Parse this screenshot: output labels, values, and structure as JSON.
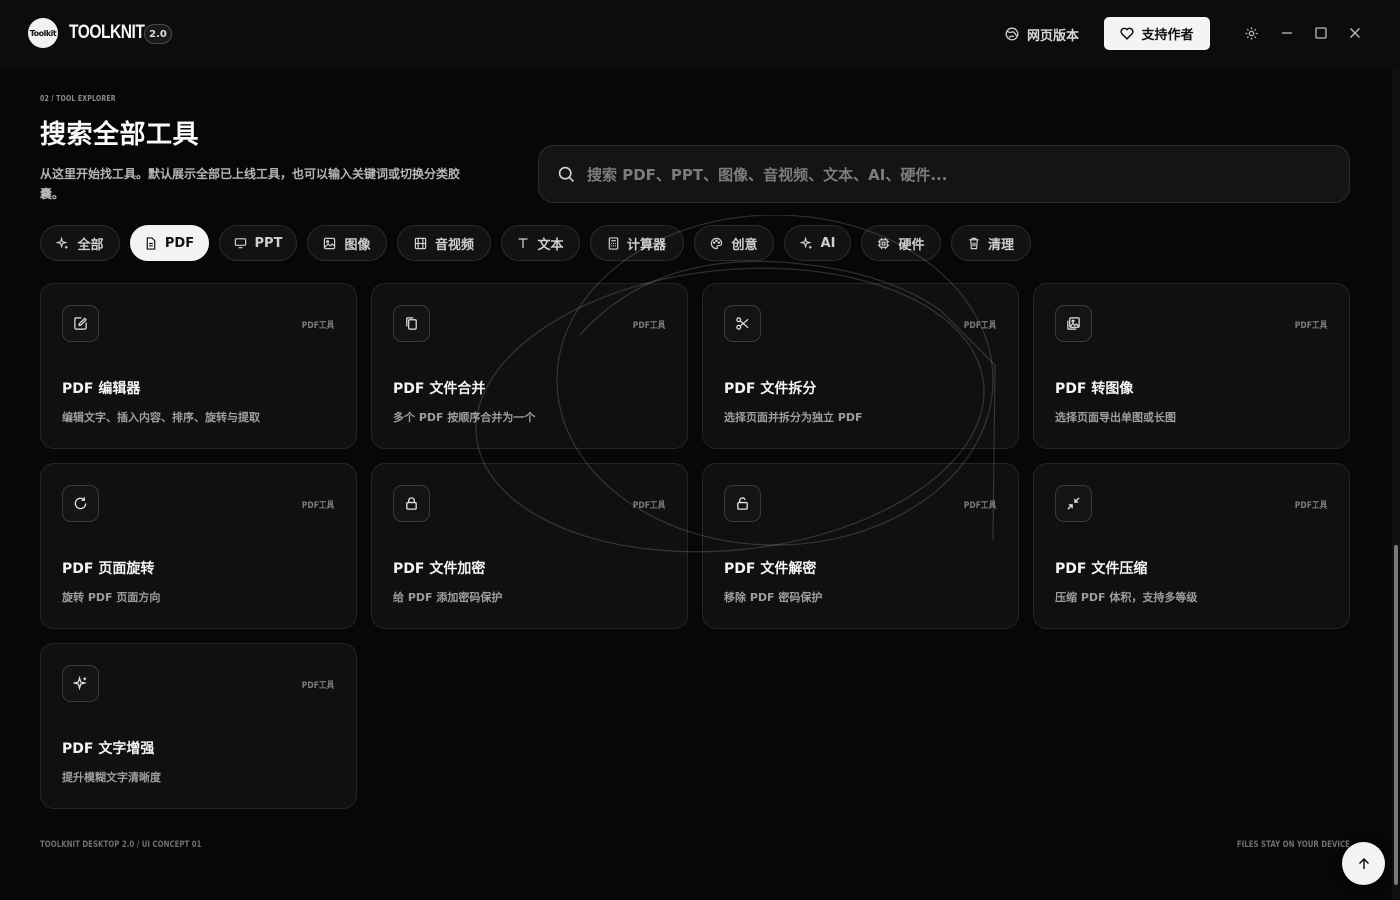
{
  "app": {
    "logo_text": "Toolkit",
    "name": "TOOLKNIT",
    "version": "2.0",
    "web_label": "网页版本",
    "support_label": "支持作者"
  },
  "header": {
    "breadcrumb": "02 / TOOL EXPLORER",
    "title": "搜索全部工具",
    "description": "从这里开始找工具。默认展示全部已上线工具，也可以输入关键词或切换分类胶囊。"
  },
  "search": {
    "placeholder": "搜索 PDF、PPT、图像、音视频、文本、AI、硬件...",
    "value": ""
  },
  "categories": [
    {
      "label": "全部",
      "icon": "sparkle-icon",
      "active": false
    },
    {
      "label": "PDF",
      "icon": "document-icon",
      "active": true
    },
    {
      "label": "PPT",
      "icon": "presentation-icon",
      "active": false
    },
    {
      "label": "图像",
      "icon": "image-icon",
      "active": false
    },
    {
      "label": "音视频",
      "icon": "film-icon",
      "active": false
    },
    {
      "label": "文本",
      "icon": "text-icon",
      "active": false
    },
    {
      "label": "计算器",
      "icon": "calculator-icon",
      "active": false
    },
    {
      "label": "创意",
      "icon": "palette-icon",
      "active": false
    },
    {
      "label": "AI",
      "icon": "ai-sparkle-icon",
      "active": false
    },
    {
      "label": "硬件",
      "icon": "chip-icon",
      "active": false
    },
    {
      "label": "清理",
      "icon": "trash-icon",
      "active": false
    }
  ],
  "tools": [
    {
      "title": "PDF 编辑器",
      "desc": "编辑文字、插入内容、排序、旋转与提取",
      "tag": "PDF工具",
      "icon": "edit-icon"
    },
    {
      "title": "PDF 文件合并",
      "desc": "多个 PDF 按顺序合并为一个",
      "tag": "PDF工具",
      "icon": "copy-icon"
    },
    {
      "title": "PDF 文件拆分",
      "desc": "选择页面并拆分为独立 PDF",
      "tag": "PDF工具",
      "icon": "scissors-icon"
    },
    {
      "title": "PDF 转图像",
      "desc": "选择页面导出单图或长图",
      "tag": "PDF工具",
      "icon": "images-icon"
    },
    {
      "title": "PDF 页面旋转",
      "desc": "旋转 PDF 页面方向",
      "tag": "PDF工具",
      "icon": "rotate-icon"
    },
    {
      "title": "PDF 文件加密",
      "desc": "给 PDF 添加密码保护",
      "tag": "PDF工具",
      "icon": "lock-icon"
    },
    {
      "title": "PDF 文件解密",
      "desc": "移除 PDF 密码保护",
      "tag": "PDF工具",
      "icon": "unlock-icon"
    },
    {
      "title": "PDF 文件压缩",
      "desc": "压缩 PDF 体积，支持多等级",
      "tag": "PDF工具",
      "icon": "compress-icon"
    },
    {
      "title": "PDF 文字增强",
      "desc": "提升模糊文字清晰度",
      "tag": "PDF工具",
      "icon": "sparkles-icon"
    }
  ],
  "footer": {
    "left": "TOOLKNIT DESKTOP 2.0 / UI CONCEPT 01",
    "right": "FILES STAY ON YOUR DEVICE"
  },
  "colors": {
    "background": "#070707",
    "card": "#101010",
    "accent": "#f3f3f3"
  }
}
